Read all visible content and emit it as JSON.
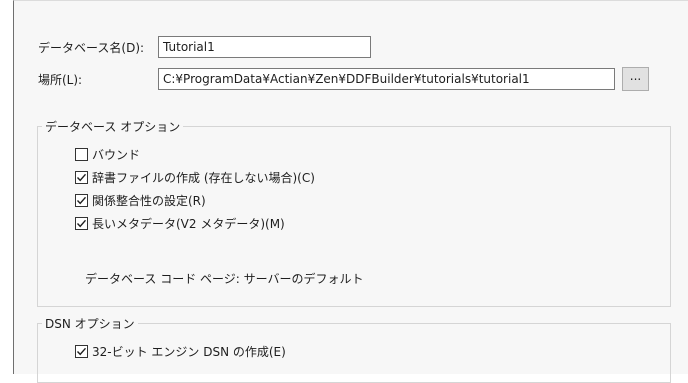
{
  "database": {
    "name_label": "データベース名(D):",
    "name_value": "Tutorial1",
    "location_label": "場所(L):",
    "location_value": "C:¥ProgramData¥Actian¥Zen¥DDFBuilder¥tutorials¥tutorial1",
    "browse_label": "..."
  },
  "db_options": {
    "title": "データベース オプション",
    "items": [
      {
        "label": "バウンド",
        "checked": false
      },
      {
        "label": "辞書ファイルの作成 (存在しない場合)(C)",
        "checked": true
      },
      {
        "label": "関係整合性の設定(R)",
        "checked": true
      },
      {
        "label": "長いメタデータ(V2 メタデータ)(M)",
        "checked": true
      }
    ],
    "code_page_text": "データベース コード ページ: サーバーのデフォルト"
  },
  "dsn_options": {
    "title": "DSN オプション",
    "items": [
      {
        "label": "32-ビット エンジン DSN の作成(E)",
        "checked": true
      }
    ]
  }
}
